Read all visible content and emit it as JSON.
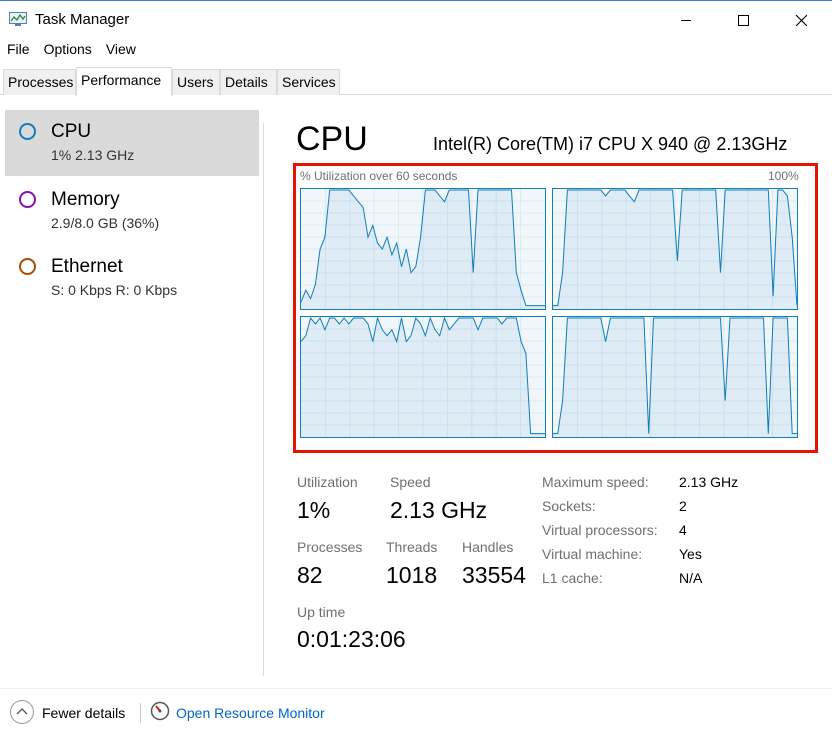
{
  "window": {
    "title": "Task Manager"
  },
  "menu": [
    "File",
    "Options",
    "View"
  ],
  "tabs": [
    {
      "label": "Processes",
      "active": false
    },
    {
      "label": "Performance",
      "active": true
    },
    {
      "label": "Users",
      "active": false
    },
    {
      "label": "Details",
      "active": false
    },
    {
      "label": "Services",
      "active": false
    }
  ],
  "sidebar": {
    "items": [
      {
        "name": "CPU",
        "sub": "1% 2.13 GHz",
        "color": "#117dbb",
        "selected": true,
        "icon": "cpu-circle-icon"
      },
      {
        "name": "Memory",
        "sub": "2.9/8.0 GB (36%)",
        "color": "#8b12ae",
        "selected": false,
        "icon": "memory-circle-icon"
      },
      {
        "name": "Ethernet",
        "sub": "S: 0 Kbps R: 0 Kbps",
        "color": "#a74f01",
        "selected": false,
        "icon": "ethernet-circle-icon"
      }
    ]
  },
  "cpu": {
    "heading": "CPU",
    "model": "Intel(R) Core(TM) i7 CPU X 940 @ 2.13GHz",
    "graph_caption": "% Utilization over 60 seconds",
    "graph_max": "100%",
    "accent": "#117dbb",
    "highlight_color": "#e51400"
  },
  "stats": {
    "utilization_label": "Utilization",
    "utilization_value": "1%",
    "speed_label": "Speed",
    "speed_value": "2.13 GHz",
    "processes_label": "Processes",
    "processes_value": "82",
    "threads_label": "Threads",
    "threads_value": "1018",
    "handles_label": "Handles",
    "handles_value": "33554",
    "uptime_label": "Up time",
    "uptime_value": "0:01:23:06"
  },
  "details": [
    {
      "label": "Maximum speed:",
      "value": "2.13 GHz"
    },
    {
      "label": "Sockets:",
      "value": "2"
    },
    {
      "label": "Virtual processors:",
      "value": "4"
    },
    {
      "label": "Virtual machine:",
      "value": "Yes"
    },
    {
      "label": "L1 cache:",
      "value": "N/A"
    }
  ],
  "footer": {
    "fewer_details": "Fewer details",
    "open_resource_monitor": "Open Resource Monitor"
  },
  "chart_data": {
    "type": "line",
    "title": "% Utilization over 60 seconds",
    "ylim": [
      0,
      100
    ],
    "series": [
      {
        "values": [
          5,
          15,
          8,
          20,
          50,
          60,
          100,
          100,
          100,
          100,
          100,
          95,
          90,
          85,
          60,
          70,
          55,
          50,
          60,
          45,
          55,
          35,
          50,
          30,
          35,
          60,
          100,
          100,
          100,
          95,
          90,
          100,
          100,
          100,
          100,
          100,
          30,
          100,
          100,
          100,
          100,
          100,
          100,
          100,
          100,
          30,
          15,
          2,
          2,
          2,
          2,
          2
        ]
      },
      {
        "values": [
          2,
          2,
          30,
          100,
          100,
          100,
          100,
          100,
          100,
          100,
          100,
          95,
          100,
          100,
          100,
          100,
          95,
          90,
          100,
          100,
          100,
          100,
          100,
          100,
          100,
          100,
          40,
          100,
          100,
          100,
          100,
          100,
          100,
          100,
          100,
          30,
          100,
          100,
          100,
          100,
          100,
          100,
          100,
          100,
          100,
          100,
          10,
          100,
          100,
          95,
          60,
          2
        ]
      },
      {
        "values": [
          80,
          85,
          100,
          95,
          100,
          90,
          100,
          100,
          95,
          100,
          95,
          100,
          100,
          100,
          95,
          80,
          100,
          90,
          85,
          90,
          80,
          100,
          80,
          85,
          100,
          95,
          85,
          100,
          90,
          85,
          100,
          90,
          95,
          100,
          100,
          100,
          100,
          90,
          100,
          100,
          100,
          100,
          95,
          100,
          100,
          100,
          80,
          70,
          2,
          2,
          2,
          2
        ]
      },
      {
        "values": [
          2,
          2,
          30,
          100,
          100,
          100,
          100,
          100,
          100,
          100,
          100,
          80,
          100,
          100,
          100,
          100,
          100,
          100,
          100,
          100,
          2,
          100,
          100,
          100,
          100,
          100,
          100,
          100,
          100,
          100,
          100,
          100,
          100,
          100,
          100,
          100,
          30,
          100,
          100,
          100,
          100,
          100,
          100,
          100,
          100,
          2,
          100,
          100,
          100,
          100,
          2,
          2
        ]
      }
    ]
  }
}
